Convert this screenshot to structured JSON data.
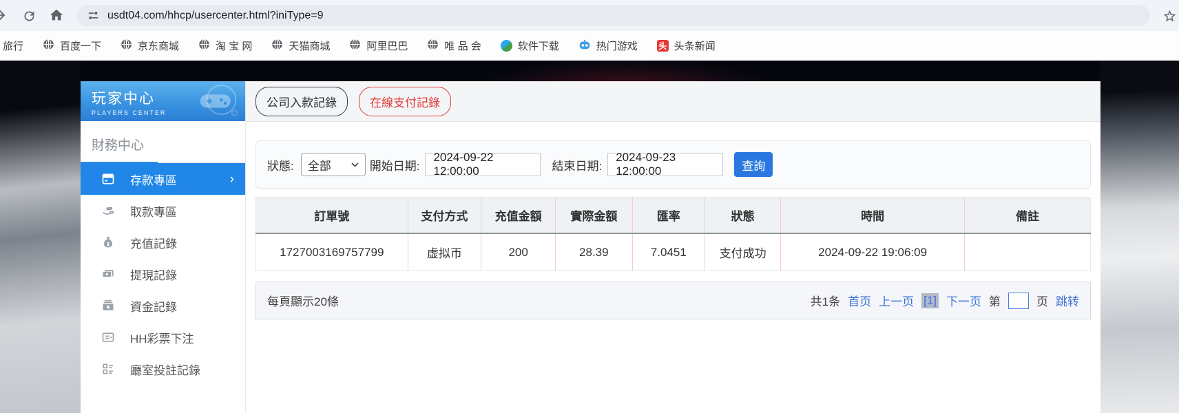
{
  "browser": {
    "url": "usdt04.com/hhcp/usercenter.html?iniType=9",
    "bookmarks": [
      {
        "label": "旅行",
        "icon": "none"
      },
      {
        "label": "百度一下",
        "icon": "globe-icon"
      },
      {
        "label": "京东商城",
        "icon": "globe-icon"
      },
      {
        "label": "淘 宝 网",
        "icon": "globe-icon"
      },
      {
        "label": "天猫商城",
        "icon": "globe-icon"
      },
      {
        "label": "阿里巴巴",
        "icon": "globe-icon"
      },
      {
        "label": "唯 品 会",
        "icon": "globe-icon"
      },
      {
        "label": "软件下载",
        "icon": "software-icon"
      },
      {
        "label": "热门游戏",
        "icon": "game-icon"
      },
      {
        "label": "头条新闻",
        "icon": "toutiao-icon",
        "glyph": "头"
      }
    ]
  },
  "sidebar": {
    "title": "玩家中心",
    "subtitle": "PLAYERS CENTER",
    "section": "財務中心",
    "items": [
      {
        "label": "存款專區",
        "active": true
      },
      {
        "label": "取款專區",
        "active": false
      },
      {
        "label": "充值記錄",
        "active": false
      },
      {
        "label": "提現記錄",
        "active": false
      },
      {
        "label": "資金記錄",
        "active": false
      },
      {
        "label": "HH彩票下注",
        "active": false
      },
      {
        "label": "廳室投註記錄",
        "active": false
      }
    ],
    "active_chevron": "›"
  },
  "tabs": {
    "company": "公司入款記錄",
    "online": "在線支付記錄"
  },
  "filters": {
    "status_label": "狀態:",
    "status_value": "全部",
    "start_label": "開始日期:",
    "start_value": "2024-09-22 12:00:00",
    "end_label": "結束日期:",
    "end_value": "2024-09-23 12:00:00",
    "query_label": "查詢"
  },
  "table": {
    "headers": [
      "訂單號",
      "支付方式",
      "充值金額",
      "實際金額",
      "匯率",
      "狀態",
      "時間",
      "備註"
    ],
    "rows": [
      [
        "1727003169757799",
        "虚拟币",
        "200",
        "28.39",
        "7.0451",
        "支付成功",
        "2024-09-22 19:06:09",
        ""
      ]
    ]
  },
  "pagination": {
    "per_page": "每頁顯示20條",
    "total": "共1条",
    "first": "首页",
    "prev": "上一页",
    "current": "[1]",
    "next": "下一页",
    "page_prefix": "第",
    "page_suffix": "页",
    "jump": "跳转",
    "jump_value": ""
  },
  "colors": {
    "sidebar_active_blue": "#2087e8",
    "query_button_blue": "#2a78df",
    "tab_red": "#e23c3c",
    "link_blue": "#3a6fd8",
    "table_divider_pink": "#f5cdcd"
  }
}
